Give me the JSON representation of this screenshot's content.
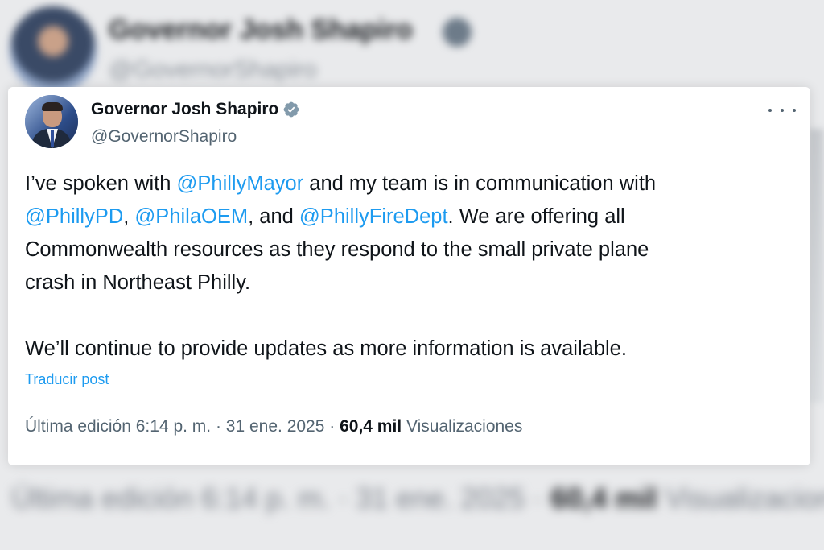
{
  "background": {
    "name": "Governor Josh Shapiro",
    "handle": "@GovernorShapiro",
    "meta_prefix": "Última edición 6:14 p. m. · 31 ene. 2025 · ",
    "views_count": "60,4 mil",
    "views_label": "Visualizaciones"
  },
  "author": {
    "display_name": "Governor Josh Shapiro",
    "handle": "@GovernorShapiro",
    "verified_icon": "verified-badge-icon"
  },
  "menu": {
    "icon": "more-options-icon"
  },
  "tweet": {
    "line1_a": "I’ve spoken with ",
    "mention_mayor": "@PhillyMayor",
    "line1_b": " and my team is in communication with",
    "mention_pd": "@PhillyPD",
    "sep1": ", ",
    "mention_oem": "@PhilaOEM",
    "sep2": ", and ",
    "mention_fire": "@PhillyFireDept",
    "line2_b": ". We are offering all",
    "line3": "Commonwealth resources as they respond to the small private plane",
    "line4": "crash in Northeast Philly.",
    "line5": "We’ll continue to provide updates as more information is available."
  },
  "translate_label": "Traducir post",
  "meta": {
    "edited_label": "Última edición",
    "time": "6:14 p. m.",
    "sep": " · ",
    "date": "31 ene. 2025",
    "views_count": "60,4 mil",
    "views_label": "Visualizaciones"
  },
  "colors": {
    "accent": "#1d9bf0",
    "text": "#0f1419",
    "secondary": "#536471"
  }
}
